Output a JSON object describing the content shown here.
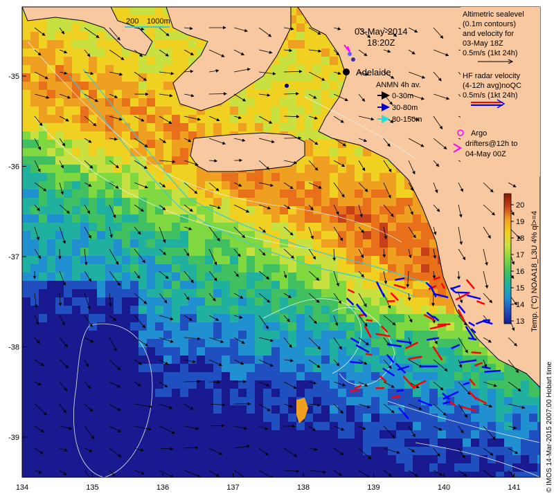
{
  "axes": {
    "lon_ticks": [
      "134",
      "135",
      "136",
      "137",
      "138",
      "139",
      "140",
      "141"
    ],
    "lat_ticks": [
      "-35",
      "-36",
      "-37",
      "-38",
      "-39"
    ]
  },
  "title": {
    "date": "03-May-2014",
    "time": "18:20Z"
  },
  "scale_bar": {
    "label_200": "200",
    "label_1000": "1000m"
  },
  "city": {
    "label": "Adelaide"
  },
  "altimetric_legend": {
    "line1": "Altimetric sealevel",
    "line2": "(0.1m contours)",
    "line3": "and velocity for",
    "line4": "03-May 18Z",
    "line5": "0.5m/s (1kt 24h)"
  },
  "hf_radar_legend": {
    "line1": "HF radar velocity",
    "line2": "(4-12h avg)noQC",
    "line3": "0.5m/s (1kt 24h)"
  },
  "anmn_legend": {
    "title": "ANMN 4h av.",
    "items": [
      {
        "label": "0-30m",
        "color": "#000000"
      },
      {
        "label": "30-80m",
        "color": "#0000dd"
      },
      {
        "label": "80-150m",
        "color": "#22dddd"
      }
    ]
  },
  "argo_legend": {
    "line1": "Argo",
    "line2": "drifters@12h to",
    "line3": "04-May 00Z",
    "color": "#ff00ff"
  },
  "colorbar": {
    "ticks": [
      "20",
      "19",
      "18",
      "17",
      "16",
      "15",
      "14",
      "13"
    ],
    "label": "Temp. (°C) NOAA18_L3U 4% ql>=4",
    "colors": [
      "#8b1a00",
      "#c8401a",
      "#e8701a",
      "#f0a020",
      "#f0d020",
      "#c8e040",
      "#80d840",
      "#40c060",
      "#20b0a0",
      "#2090d0",
      "#2050c0",
      "#1a1a90"
    ]
  },
  "credit": "© IMOS 14-Mar-2015 2007:00 Hobart time",
  "colors": {
    "land": "#f8c8a0",
    "coast": "#000000",
    "contour": "#e8f0e8",
    "bathy": "#40c8d0",
    "hf_radar_a": "#ff0000",
    "hf_radar_b": "#0000ff"
  }
}
